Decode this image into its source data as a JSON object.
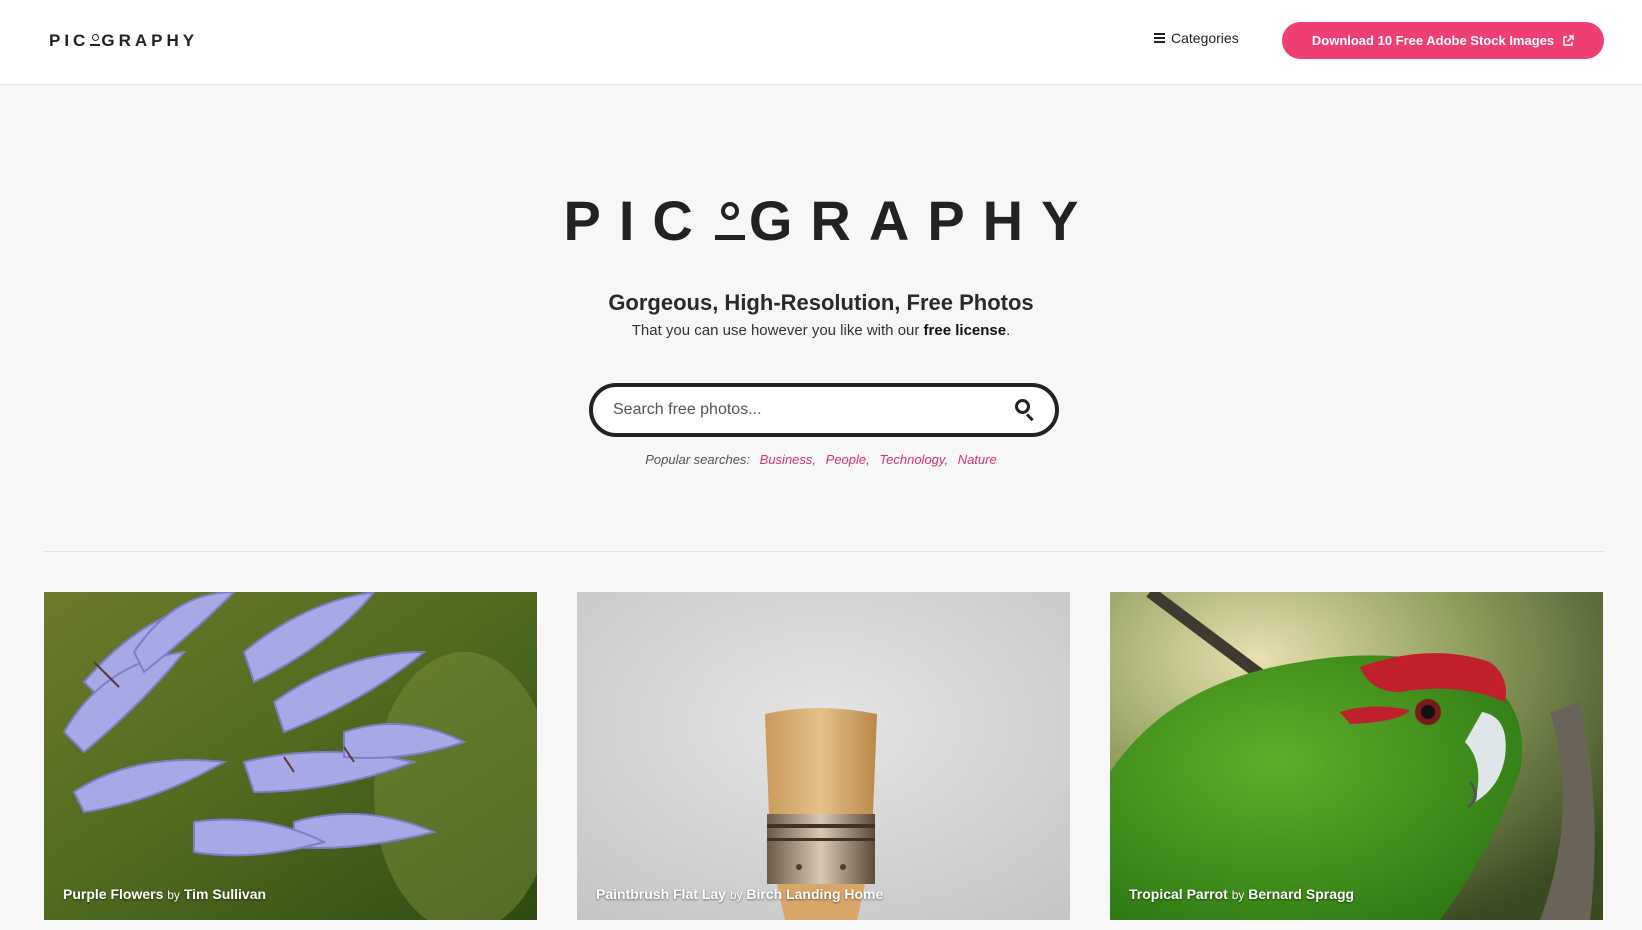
{
  "header": {
    "logo_left": "PIC",
    "logo_right": "GRAPHY",
    "categories_label": "Categories",
    "cta_label": "Download 10 Free Adobe Stock Images"
  },
  "hero": {
    "logo_left": "PIC",
    "logo_right": "GRAPHY",
    "headline": "Gorgeous, High-Resolution, Free Photos",
    "subline_prefix": "That you can use however you like with our ",
    "subline_link": "free license",
    "subline_suffix": "."
  },
  "search": {
    "placeholder": "Search free photos..."
  },
  "popular": {
    "label": "Popular searches:",
    "terms": [
      "Business",
      "People",
      "Technology",
      "Nature"
    ]
  },
  "photos": [
    {
      "title": "Purple Flowers",
      "by": "by",
      "author": "Tim Sullivan"
    },
    {
      "title": "Paintbrush Flat Lay",
      "by": "by",
      "author": "Birch Landing Home"
    },
    {
      "title": "Tropical Parrot",
      "by": "by",
      "author": "Bernard Spragg"
    }
  ],
  "colors": {
    "accent": "#ef3f72",
    "link": "#d6336c",
    "text": "#222222"
  },
  "icons": [
    "hamburger-icon",
    "external-link-icon",
    "search-icon"
  ]
}
